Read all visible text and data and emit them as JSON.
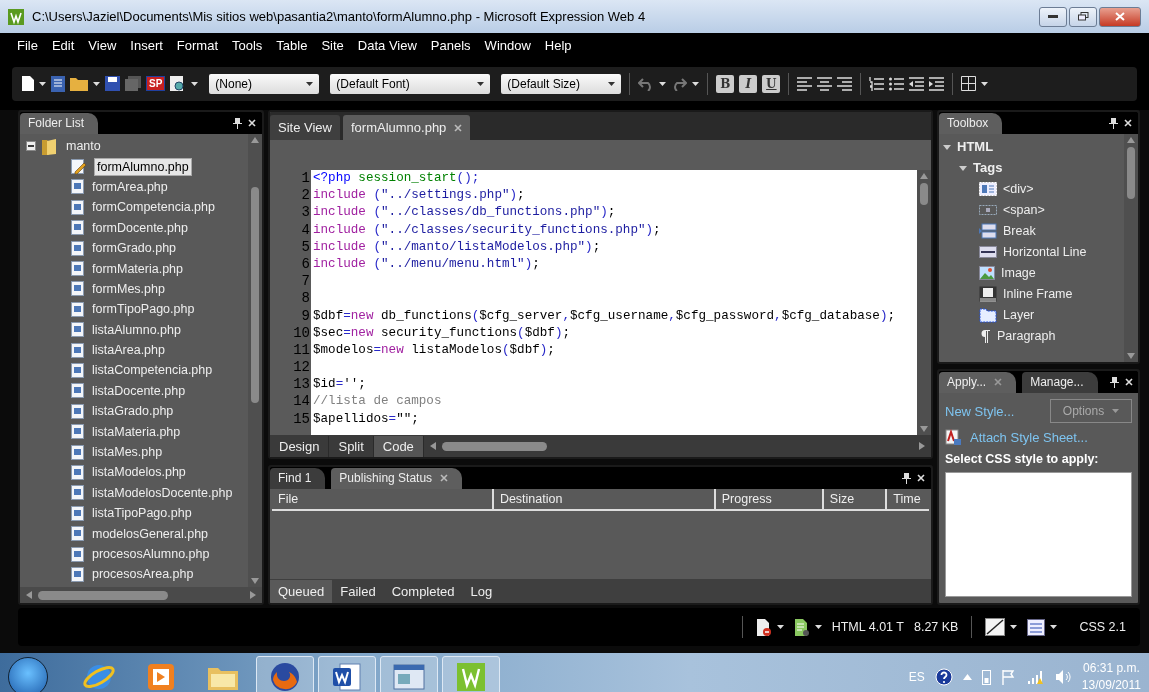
{
  "window": {
    "title": "C:\\Users\\Jaziel\\Documents\\Mis sitios web\\pasantia2\\manto\\formAlumno.php - Microsoft Expression Web 4"
  },
  "menu": [
    "File",
    "Edit",
    "View",
    "Insert",
    "Format",
    "Tools",
    "Table",
    "Site",
    "Data View",
    "Panels",
    "Window",
    "Help"
  ],
  "toolbar": {
    "sp_label": "SP",
    "dropdowns": [
      "(None)",
      "(Default Font)",
      "(Default Size)"
    ],
    "format_buttons": [
      "B",
      "I",
      "U"
    ]
  },
  "folder_list": {
    "title": "Folder List",
    "root": {
      "label": "manto",
      "expanded": true,
      "children": [
        {
          "label": "formAlumno.php",
          "selected": true,
          "kind": "edited"
        },
        {
          "label": "formArea.php",
          "selected": false,
          "kind": "page"
        },
        {
          "label": "formCompetencia.php",
          "selected": false,
          "kind": "page"
        },
        {
          "label": "formDocente.php",
          "selected": false,
          "kind": "page"
        },
        {
          "label": "formGrado.php",
          "selected": false,
          "kind": "page"
        },
        {
          "label": "formMateria.php",
          "selected": false,
          "kind": "page"
        },
        {
          "label": "formMes.php",
          "selected": false,
          "kind": "page"
        },
        {
          "label": "formTipoPago.php",
          "selected": false,
          "kind": "page"
        },
        {
          "label": "listaAlumno.php",
          "selected": false,
          "kind": "page"
        },
        {
          "label": "listaArea.php",
          "selected": false,
          "kind": "page"
        },
        {
          "label": "listaCompetencia.php",
          "selected": false,
          "kind": "page"
        },
        {
          "label": "listaDocente.php",
          "selected": false,
          "kind": "page"
        },
        {
          "label": "listaGrado.php",
          "selected": false,
          "kind": "page"
        },
        {
          "label": "listaMateria.php",
          "selected": false,
          "kind": "page"
        },
        {
          "label": "listaMes.php",
          "selected": false,
          "kind": "page"
        },
        {
          "label": "listaModelos.php",
          "selected": false,
          "kind": "page"
        },
        {
          "label": "listaModelosDocente.php",
          "selected": false,
          "kind": "page"
        },
        {
          "label": "listaTipoPago.php",
          "selected": false,
          "kind": "page"
        },
        {
          "label": "modelosGeneral.php",
          "selected": false,
          "kind": "page"
        },
        {
          "label": "procesosAlumno.php",
          "selected": false,
          "kind": "page"
        },
        {
          "label": "procesosArea.php",
          "selected": false,
          "kind": "page"
        }
      ]
    }
  },
  "document_tabs": [
    {
      "label": "Site View",
      "selected": false,
      "closable": false
    },
    {
      "label": "formAlumno.php",
      "selected": true,
      "closable": true
    }
  ],
  "editor": {
    "lines": [
      {
        "number": "1",
        "tokens": [
          {
            "kind": "tag",
            "text": "<?php"
          },
          {
            "kind": "fn",
            "text": " session_start"
          },
          {
            "kind": "op",
            "text": "();"
          }
        ]
      },
      {
        "number": "2",
        "tokens": [
          {
            "kind": "kw",
            "text": "include"
          },
          {
            "kind": "op",
            "text": " ("
          },
          {
            "kind": "str",
            "text": "\"../settings.php\""
          },
          {
            "kind": "op",
            "text": ")"
          },
          {
            "kind": "txt",
            "text": ";"
          }
        ]
      },
      {
        "number": "3",
        "tokens": [
          {
            "kind": "kw",
            "text": "include"
          },
          {
            "kind": "op",
            "text": " ("
          },
          {
            "kind": "str",
            "text": "\"../classes/db_functions.php\""
          },
          {
            "kind": "op",
            "text": ")"
          },
          {
            "kind": "txt",
            "text": ";"
          }
        ]
      },
      {
        "number": "4",
        "tokens": [
          {
            "kind": "kw",
            "text": "include"
          },
          {
            "kind": "op",
            "text": " ("
          },
          {
            "kind": "str",
            "text": "\"../classes/security_functions.php\""
          },
          {
            "kind": "op",
            "text": ")"
          },
          {
            "kind": "txt",
            "text": ";"
          }
        ]
      },
      {
        "number": "5",
        "tokens": [
          {
            "kind": "kw",
            "text": "include"
          },
          {
            "kind": "op",
            "text": " ("
          },
          {
            "kind": "str",
            "text": "\"../manto/listaModelos.php\""
          },
          {
            "kind": "op",
            "text": ")"
          },
          {
            "kind": "txt",
            "text": ";"
          }
        ]
      },
      {
        "number": "6",
        "tokens": [
          {
            "kind": "kw",
            "text": "include"
          },
          {
            "kind": "op",
            "text": " ("
          },
          {
            "kind": "str",
            "text": "\"../menu/menu.html\""
          },
          {
            "kind": "op",
            "text": ")"
          },
          {
            "kind": "txt",
            "text": ";"
          }
        ]
      },
      {
        "number": "7"
      },
      {
        "number": "8"
      },
      {
        "number": "9",
        "tokens": [
          {
            "kind": "var",
            "text": "$dbf"
          },
          {
            "kind": "op",
            "text": "="
          },
          {
            "kind": "kw",
            "text": "new"
          },
          {
            "kind": "txt",
            "text": " db_functions"
          },
          {
            "kind": "op",
            "text": "("
          },
          {
            "kind": "var",
            "text": "$cfg_server"
          },
          {
            "kind": "op",
            "text": ","
          },
          {
            "kind": "var",
            "text": "$cfg_username"
          },
          {
            "kind": "op",
            "text": ","
          },
          {
            "kind": "var",
            "text": "$cfg_password"
          },
          {
            "kind": "op",
            "text": ","
          },
          {
            "kind": "var",
            "text": "$cfg_database"
          },
          {
            "kind": "op",
            "text": ")"
          },
          {
            "kind": "txt",
            "text": ";"
          }
        ]
      },
      {
        "number": "10",
        "tokens": [
          {
            "kind": "var",
            "text": "$sec"
          },
          {
            "kind": "op",
            "text": "="
          },
          {
            "kind": "kw",
            "text": "new"
          },
          {
            "kind": "txt",
            "text": " security_functions"
          },
          {
            "kind": "op",
            "text": "("
          },
          {
            "kind": "var",
            "text": "$dbf"
          },
          {
            "kind": "op",
            "text": ")"
          },
          {
            "kind": "txt",
            "text": ";"
          }
        ]
      },
      {
        "number": "11",
        "tokens": [
          {
            "kind": "var",
            "text": "$modelos"
          },
          {
            "kind": "op",
            "text": "="
          },
          {
            "kind": "kw",
            "text": "new"
          },
          {
            "kind": "txt",
            "text": " listaModelos"
          },
          {
            "kind": "op",
            "text": "("
          },
          {
            "kind": "var",
            "text": "$dbf"
          },
          {
            "kind": "op",
            "text": ")"
          },
          {
            "kind": "txt",
            "text": ";"
          }
        ]
      },
      {
        "number": "12"
      },
      {
        "number": "13",
        "tokens": [
          {
            "kind": "var",
            "text": "$id"
          },
          {
            "kind": "op",
            "text": "="
          },
          {
            "kind": "txt",
            "text": "'';"
          }
        ]
      },
      {
        "number": "14",
        "tokens": [
          {
            "kind": "cmt",
            "text": "//lista de campos"
          }
        ]
      },
      {
        "number": "15",
        "tokens": [
          {
            "kind": "var",
            "text": "$apellidos"
          },
          {
            "kind": "op",
            "text": "="
          },
          {
            "kind": "txt",
            "text": "\"\";"
          }
        ]
      }
    ]
  },
  "view_tabs": [
    {
      "label": "Design",
      "selected": false
    },
    {
      "label": "Split",
      "selected": false
    },
    {
      "label": "Code",
      "selected": true
    }
  ],
  "output_panel": {
    "tabs": [
      {
        "label": "Find 1",
        "selected": false,
        "closable": false
      },
      {
        "label": "Publishing Status",
        "selected": true,
        "closable": true
      }
    ],
    "columns": [
      "File",
      "Destination",
      "Progress",
      "Size",
      "Time"
    ],
    "filters": [
      {
        "label": "Queued",
        "selected": true
      },
      {
        "label": "Failed",
        "selected": false
      },
      {
        "label": "Completed",
        "selected": false
      },
      {
        "label": "Log",
        "selected": false
      }
    ]
  },
  "toolbox": {
    "title": "Toolbox",
    "tree": [
      {
        "label": "HTML",
        "expanded": true,
        "children": [
          {
            "label": "Tags",
            "expanded": true,
            "children": [
              {
                "label": "<div>",
                "kind": "div"
              },
              {
                "label": "<span>",
                "kind": "span"
              },
              {
                "label": "Break",
                "kind": "break"
              },
              {
                "label": "Horizontal Line",
                "kind": "hr"
              },
              {
                "label": "Image",
                "kind": "image"
              },
              {
                "label": "Inline Frame",
                "kind": "iframe"
              },
              {
                "label": "Layer",
                "kind": "layer"
              },
              {
                "label": "Paragraph",
                "kind": "paragraph"
              }
            ]
          }
        ]
      }
    ]
  },
  "styles_panel": {
    "tabs": [
      {
        "label": "Apply...",
        "selected": true,
        "closable": true
      },
      {
        "label": "Manage...",
        "selected": false,
        "closable": false
      }
    ],
    "new_style": "New Style...",
    "options": {
      "label": "Options",
      "disabled": true
    },
    "attach": "Attach Style Sheet...",
    "list_label": "Select CSS style to apply:"
  },
  "status_bar": {
    "doctype": "HTML 4.01 T",
    "size": "8.27 KB",
    "css": "CSS 2.1"
  },
  "taskbar": {
    "apps": [
      {
        "kind": "browser",
        "running": false
      },
      {
        "kind": "media",
        "running": false
      },
      {
        "kind": "folder",
        "running": false
      },
      {
        "kind": "fox",
        "running": true
      },
      {
        "kind": "word",
        "running": true
      },
      {
        "kind": "window",
        "running": true
      },
      {
        "kind": "editor",
        "running": true
      }
    ],
    "language": "ES",
    "time": "06:31 p.m.",
    "date": "13/09/2011"
  }
}
